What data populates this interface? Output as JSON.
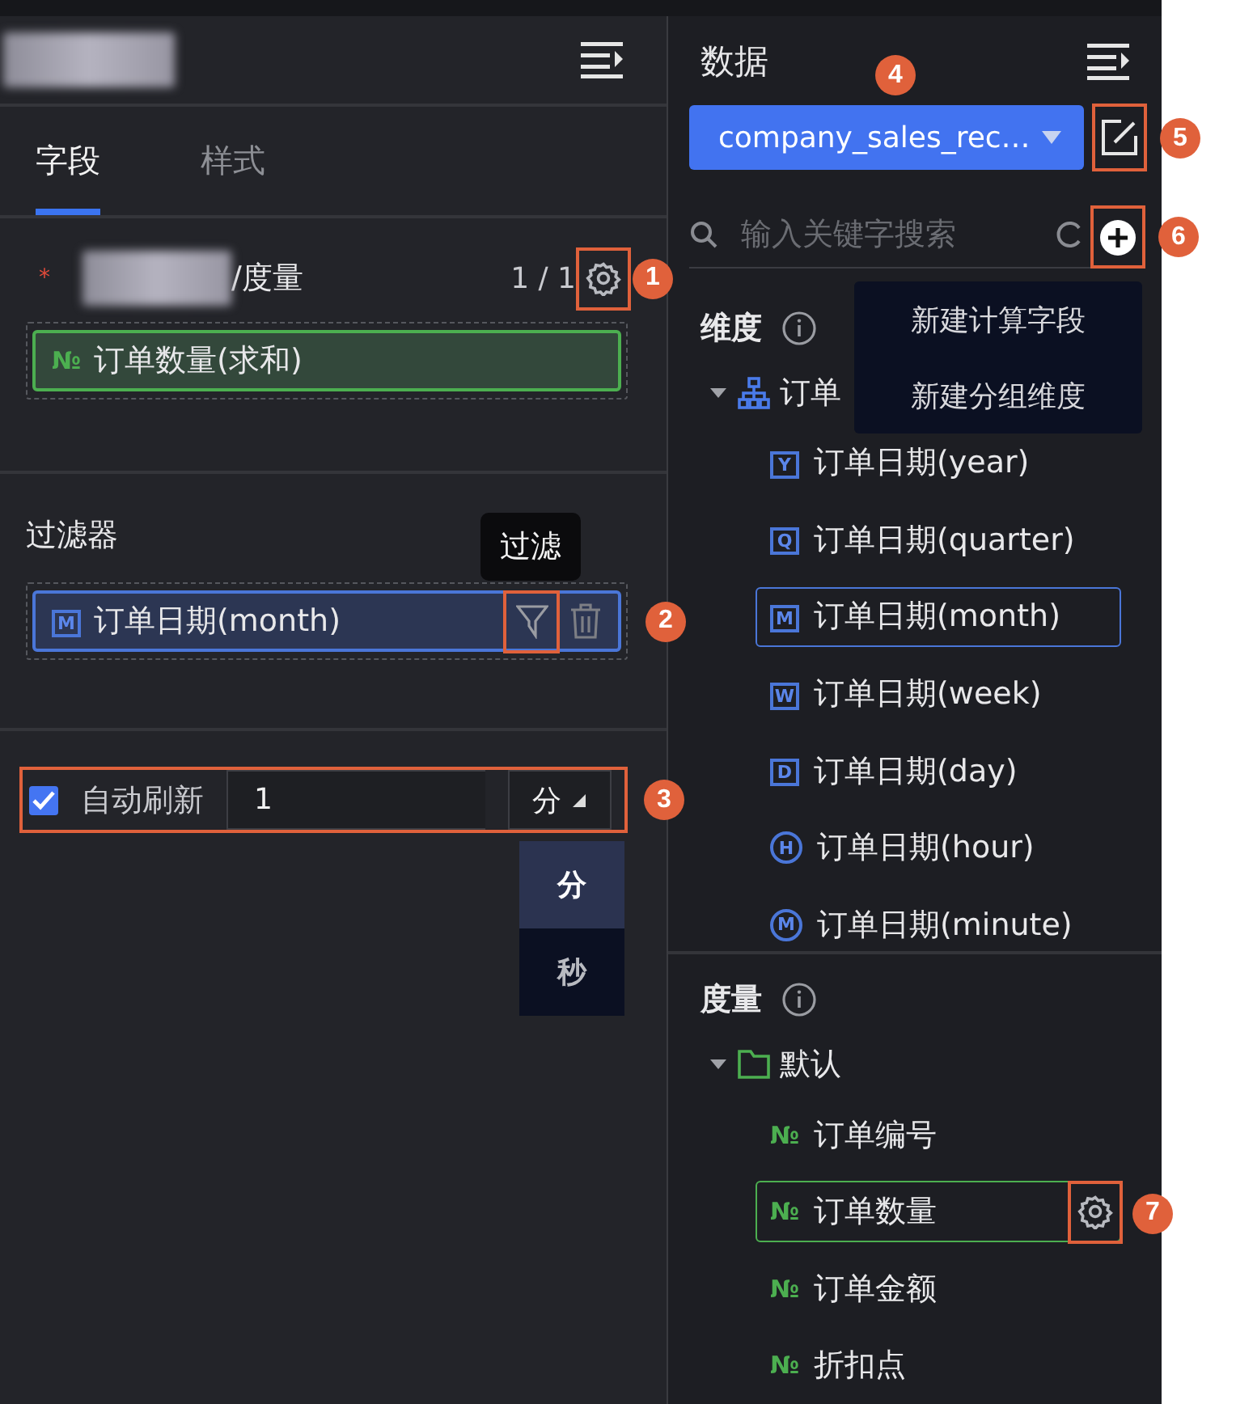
{
  "left_panel": {
    "tabs": [
      {
        "label": "字段",
        "selected": true
      },
      {
        "label": "样式",
        "selected": false
      }
    ],
    "measure_slot": {
      "required_mark": "*",
      "label": "/度量",
      "count": "1 / 1",
      "settings_callout": {
        "number": "1",
        "boxed": true
      },
      "fields": [
        {
          "mark": "№",
          "label": "订单数量(求和)"
        }
      ]
    },
    "filters": {
      "title": "过滤器",
      "tooltip": "过滤",
      "fields": [
        {
          "badge": "M",
          "label": "订单日期(month)",
          "filter_callout": {
            "number": "2",
            "boxed": true
          }
        }
      ]
    },
    "auto_refresh": {
      "checked": true,
      "label": "自动刷新",
      "value": "1",
      "unit": "分",
      "expanded": true,
      "callout": {
        "number": "3",
        "boxed": true
      },
      "options": [
        {
          "label": "分",
          "selected": true
        },
        {
          "label": "秒",
          "selected": false
        }
      ]
    }
  },
  "data_panel": {
    "title": "数据",
    "dataset": {
      "value": "company_sales_rec…",
      "callout": {
        "number": "4",
        "boxed": false
      }
    },
    "edit_callout": {
      "number": "5",
      "boxed": true
    },
    "search": {
      "placeholder": "输入关键字搜索"
    },
    "add_callout": {
      "number": "6",
      "boxed": true
    },
    "add_menu": [
      "新建计算字段",
      "新建分组维度"
    ],
    "dimensions": {
      "title": "维度",
      "items": [
        {
          "kind": "hierarchy",
          "label": "订单",
          "expanded": true,
          "children": [
            {
              "kind": "calendar",
              "badge": "Y",
              "label": "订单日期(year)",
              "selected": false
            },
            {
              "kind": "calendar",
              "badge": "Q",
              "label": "订单日期(quarter)",
              "selected": false
            },
            {
              "kind": "calendar",
              "badge": "M",
              "label": "订单日期(month)",
              "selected": true
            },
            {
              "kind": "calendar",
              "badge": "W",
              "label": "订单日期(week)",
              "selected": false
            },
            {
              "kind": "calendar",
              "badge": "D",
              "label": "订单日期(day)",
              "selected": false
            },
            {
              "kind": "time",
              "badge": "H",
              "label": "订单日期(hour)",
              "selected": false
            },
            {
              "kind": "time",
              "badge": "M",
              "label": "订单日期(minute)",
              "selected": false
            }
          ]
        }
      ]
    },
    "measures": {
      "title": "度量",
      "items": [
        {
          "kind": "folder",
          "label": "默认",
          "expanded": true,
          "children": [
            {
              "mark": "№",
              "label": "订单编号",
              "selected": false
            },
            {
              "mark": "№",
              "label": "订单数量",
              "selected": true,
              "settings_callout": {
                "number": "7",
                "boxed": true
              }
            },
            {
              "mark": "№",
              "label": "订单金额",
              "selected": false
            },
            {
              "mark": "№",
              "label": "折扣点",
              "selected": false
            }
          ]
        }
      ]
    }
  }
}
